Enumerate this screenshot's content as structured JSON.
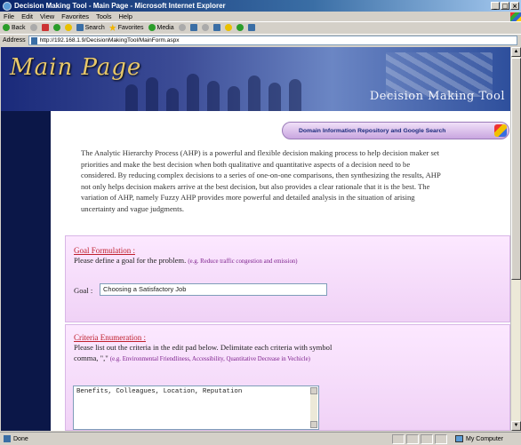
{
  "window": {
    "title": "Decision Making Tool - Main Page - Microsoft Internet Explorer",
    "controls": [
      "_",
      "□",
      "×"
    ]
  },
  "menu": [
    "File",
    "Edit",
    "View",
    "Favorites",
    "Tools",
    "Help"
  ],
  "toolbar": {
    "back": "Back",
    "search": "Search",
    "favorites": "Favorites",
    "media": "Media"
  },
  "address": {
    "label": "Address",
    "url": "http://192.168.1.9/DecisionMakingTool/MainForm.aspx"
  },
  "banner": {
    "main_title": "Main Page",
    "tool_title": "Decision Making Tool"
  },
  "domain_button": "Domain Information Repository and Google Search",
  "intro": "The Analytic Hierarchy Process (AHP) is a powerful and flexible decision making process to help decision maker set priorities and make the best decision when both qualitative and quantitative aspects of a decision need to be considered. By reducing complex decisions to a series of one-on-one comparisons, then synthesizing the results, AHP not only helps decision makers arrive at the best decision, but also provides a clear rationale that it is the best. The variation of AHP, namely Fuzzy AHP provides more powerful and detailed analysis in the situation of arising uncertainty and vague judgments.",
  "goal": {
    "title": "Goal Formulation :",
    "text": "Please define a goal for the problem.",
    "hint": "(e.g. Reduce traffic congestion and emission)",
    "label": "Goal :",
    "value": "Choosing a Satisfactory Job"
  },
  "criteria": {
    "title": "Criteria Enumeration :",
    "text1": "Please list out the criteria in the edit pad below. Delimitate each criteria with symbol",
    "text2": "comma, \",\"",
    "hint": "(e.g. Environmental Friendliness, Accessibility, Quantitative Decrease in Vechicle)",
    "value": "Benefits, Colleagues, Location, Reputation"
  },
  "status": {
    "text": "Done",
    "zone": "My Computer"
  }
}
